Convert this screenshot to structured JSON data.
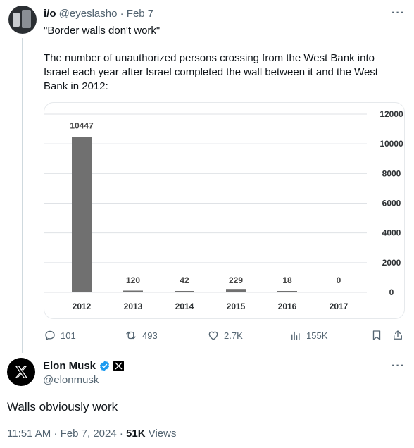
{
  "quoted_tweet": {
    "author_name": "i/o",
    "handle": "@eyeslasho",
    "separator": "·",
    "date": "Feb 7",
    "more": "···",
    "text_lines": [
      "\"Border walls don't work\"",
      "The number of unauthorized persons crossing from the West Bank into",
      "Israel each year after Israel completed the wall between it and the West",
      "Bank in 2012:"
    ],
    "actions": {
      "replies": "101",
      "reposts": "493",
      "likes": "2.7K",
      "views": "155K"
    }
  },
  "chart_data": {
    "type": "bar",
    "categories": [
      "2012",
      "2013",
      "2014",
      "2015",
      "2016",
      "2017"
    ],
    "values": [
      10447,
      120,
      42,
      229,
      18,
      0
    ],
    "data_labels": [
      "10447",
      "120",
      "42",
      "229",
      "18",
      "0"
    ],
    "y_ticks": [
      "0",
      "2000",
      "4000",
      "6000",
      "8000",
      "10000",
      "12000"
    ],
    "ylim": [
      0,
      12000
    ],
    "y_axis_side": "right",
    "grid": true,
    "bar_color": "#707070",
    "title": "",
    "xlabel": "",
    "ylabel": ""
  },
  "main_tweet": {
    "author_name": "Elon Musk",
    "handle": "@elonmusk",
    "more": "···",
    "text": "Walls obviously work",
    "time": "11:51 AM",
    "separator": "·",
    "date": "Feb 7, 2024",
    "views_count": "51K",
    "views_label": "Views",
    "verified_color": "#1d9bf0"
  }
}
